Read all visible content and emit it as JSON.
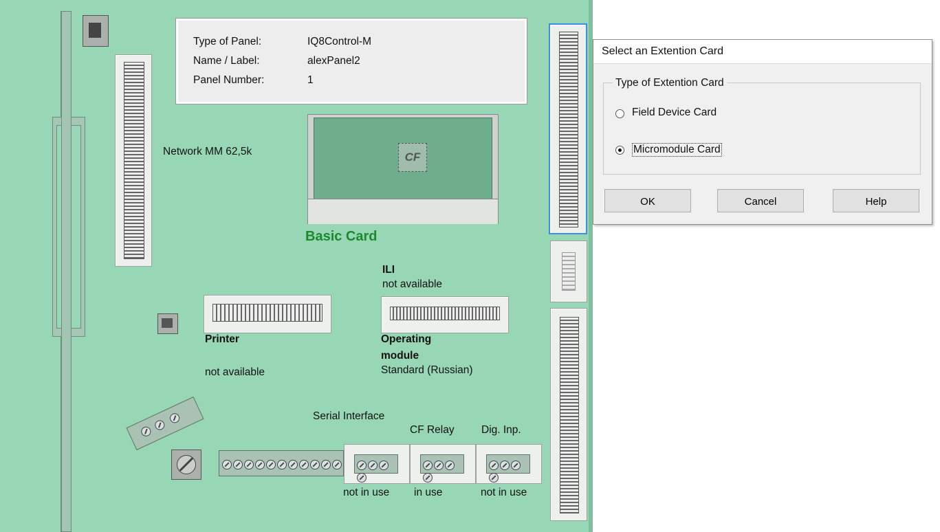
{
  "panel_info": {
    "type_label": "Type of Panel:",
    "type_value": "IQ8Control-M",
    "name_label": "Name / Label:",
    "name_value": "alexPanel2",
    "number_label": "Panel Number:",
    "number_value": "1"
  },
  "network_label": "Network MM 62,5k",
  "basic_card": {
    "cf_label": "CF",
    "title": "Basic Card"
  },
  "ili": {
    "title": "ILI",
    "status": "not available"
  },
  "printer": {
    "title": "Printer",
    "status": "not available"
  },
  "operating_module": {
    "title_line1": "Operating",
    "title_line2": "module",
    "status": "Standard (Russian)"
  },
  "terminals": {
    "serial_label": "Serial Interface",
    "cf_relay_label": "CF Relay",
    "dig_inp_label": "Dig. Inp.",
    "serial_status": "not in use",
    "cf_relay_status": "in use",
    "dig_inp_status": "not in use"
  },
  "dialog": {
    "title": "Select an Extention Card",
    "group_label": "Type of Extention Card",
    "options": [
      {
        "label": "Field Device Card",
        "selected": false
      },
      {
        "label": "Micromodule Card",
        "selected": true
      }
    ],
    "ok_label": "OK",
    "cancel_label": "Cancel",
    "help_label": "Help"
  },
  "colors": {
    "board": "#97d7b5",
    "basic_card_title": "#1c8a2c",
    "selection_border": "#3b8ee6"
  }
}
